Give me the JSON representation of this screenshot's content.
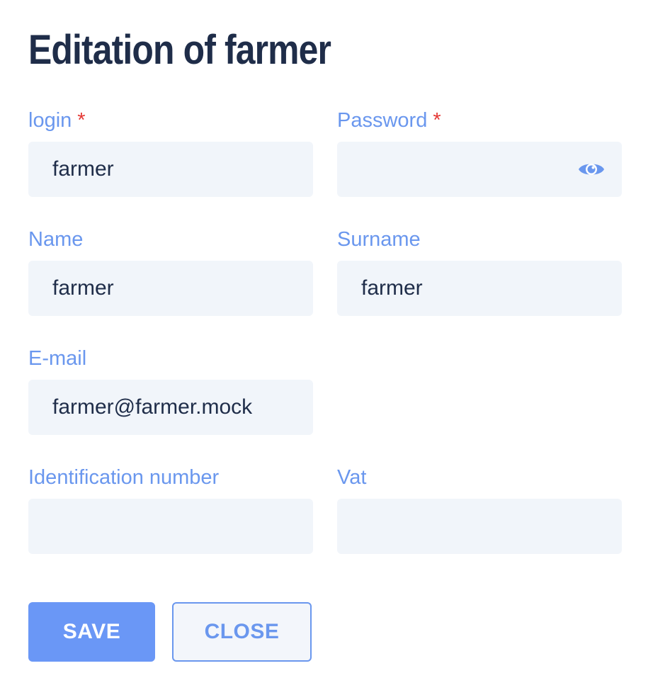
{
  "title": "Editation of farmer",
  "fields": {
    "login": {
      "label": "login",
      "required_mark": "*",
      "value": "farmer"
    },
    "password": {
      "label": "Password",
      "required_mark": "*",
      "value": "",
      "icon": "eye-icon"
    },
    "name": {
      "label": "Name",
      "value": "farmer"
    },
    "surname": {
      "label": "Surname",
      "value": "farmer"
    },
    "email": {
      "label": "E-mail",
      "value": "farmer@farmer.mock"
    },
    "identification_number": {
      "label": "Identification number",
      "value": ""
    },
    "vat": {
      "label": "Vat",
      "value": ""
    }
  },
  "buttons": {
    "save": "SAVE",
    "close": "CLOSE"
  },
  "colors": {
    "label": "#6a97ee",
    "required": "#e53935",
    "input_bg": "#f1f5fa",
    "primary": "#6a97f6",
    "title": "#1f2d49"
  }
}
